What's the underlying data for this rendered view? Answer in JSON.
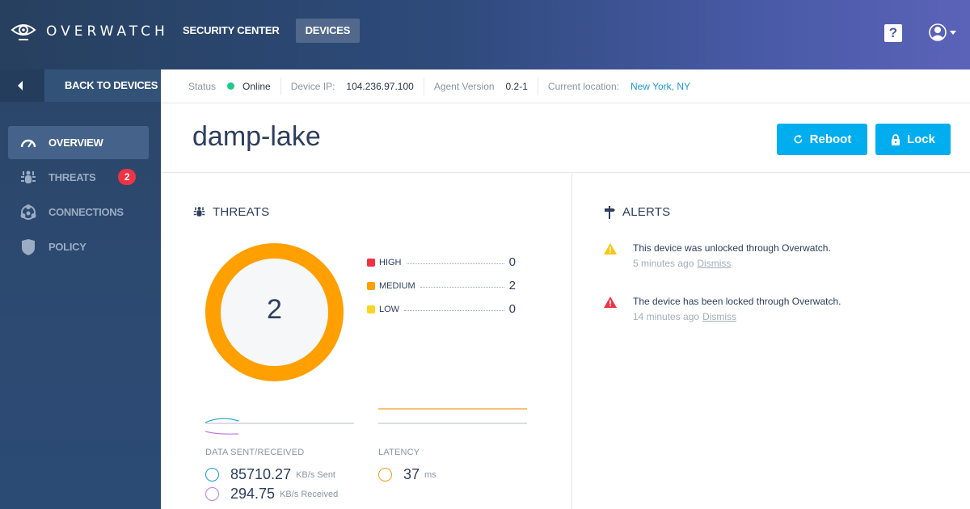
{
  "app": {
    "brand": "OVERWATCH",
    "nav": [
      {
        "label": "SECURITY CENTER",
        "active": false
      },
      {
        "label": "DEVICES",
        "active": true
      }
    ],
    "help_icon": "?"
  },
  "sidebar": {
    "back_label": "BACK TO DEVICES",
    "items": [
      {
        "label": "OVERVIEW",
        "icon": "speedometer-icon",
        "active": true
      },
      {
        "label": "THREATS",
        "icon": "bug-icon",
        "badge": "2"
      },
      {
        "label": "CONNECTIONS",
        "icon": "network-icon"
      },
      {
        "label": "POLICY",
        "icon": "shield-icon"
      }
    ]
  },
  "status": {
    "status_label": "Status",
    "status_value": "Online",
    "status_color": "#1ccb8a",
    "ip_label": "Device IP:",
    "ip_value": "104.236.97.100",
    "agent_label": "Agent Version",
    "agent_value": "0.2-1",
    "location_label": "Current location:",
    "location_value": "New York, NY"
  },
  "device": {
    "name": "damp-lake",
    "reboot_label": "Reboot",
    "lock_label": "Lock",
    "accent": "#00aeef"
  },
  "threats": {
    "title": "THREATS",
    "total": "2",
    "levels": [
      {
        "label": "HIGH",
        "value": 0,
        "color": "#ee3345"
      },
      {
        "label": "MEDIUM",
        "value": 2,
        "color": "#ff9f00"
      },
      {
        "label": "LOW",
        "value": 0,
        "color": "#f9d423"
      }
    ]
  },
  "metrics": {
    "data_label": "DATA SENT/RECEIVED",
    "sent_value": "85710.27",
    "sent_unit": "KB/s Sent",
    "sent_color": "#1c9ad0",
    "received_value": "294.75",
    "received_unit": "KB/s Received",
    "received_color": "#c27ce0",
    "latency_label": "LATENCY",
    "latency_value": "37",
    "latency_unit": "ms",
    "latency_color": "#f39c1d"
  },
  "alerts": {
    "title": "ALERTS",
    "items": [
      {
        "message": "This device was unlocked through Overwatch.",
        "time": "5 minutes ago",
        "dismiss": "Dismiss",
        "severity": "warning",
        "color": "#f9c513"
      },
      {
        "message": "The device has been locked through Overwatch.",
        "time": "14 minutes ago",
        "dismiss": "Dismiss",
        "severity": "critical",
        "color": "#ee3345"
      }
    ]
  }
}
